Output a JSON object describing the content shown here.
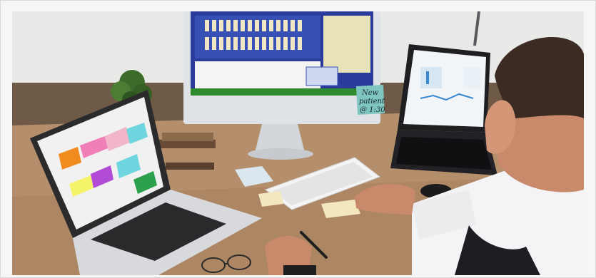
{
  "photo": {
    "sticky_note": {
      "line1": "New",
      "line2": "patient",
      "line3": "@ 1:30"
    }
  },
  "colors": {
    "wall": "#e9e9e8",
    "floor": "#6e5a47",
    "desk": "#b58f6c",
    "shirt": "#f4f4f6",
    "skin": "#c98a6c",
    "monitor_screen": "#2a3b9c",
    "sticky": "#7ec6bf"
  }
}
